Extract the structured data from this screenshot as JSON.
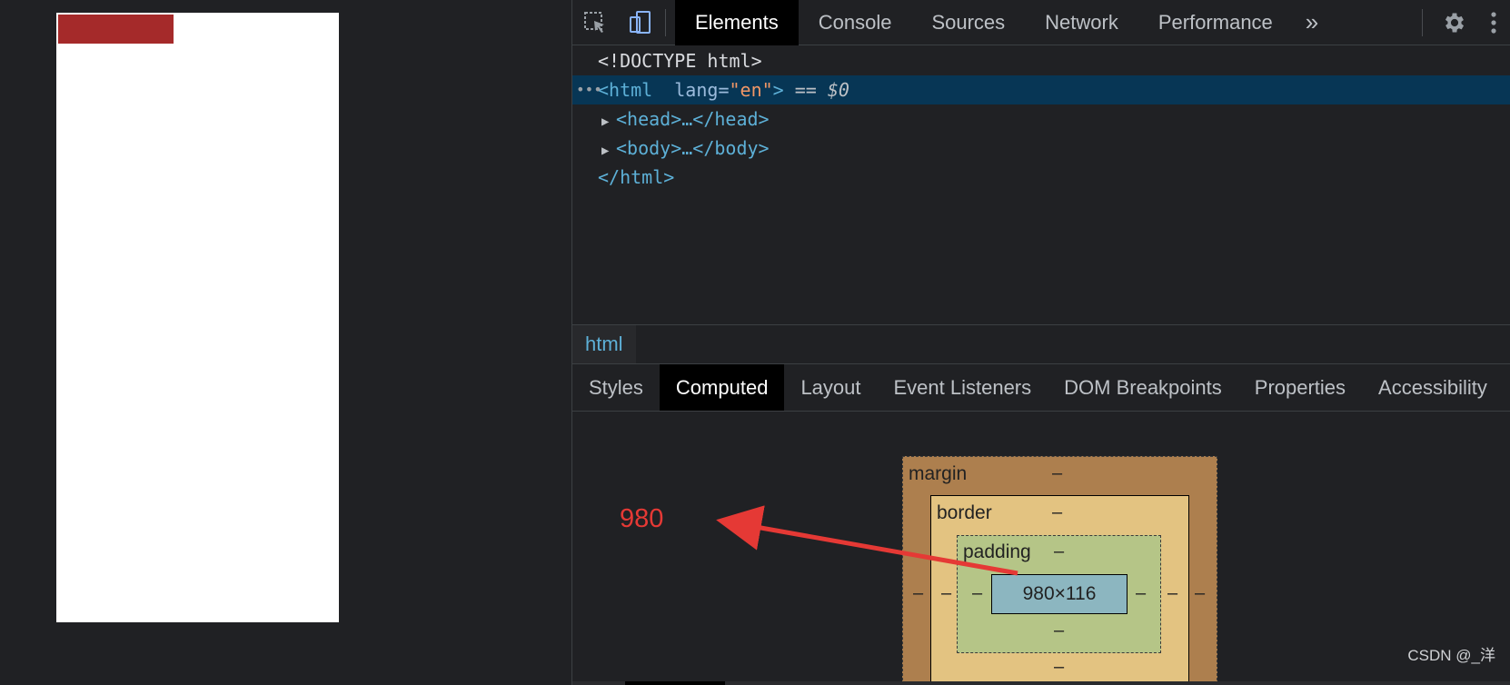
{
  "devtools": {
    "main_tabs": [
      "Elements",
      "Console",
      "Sources",
      "Network",
      "Performance"
    ],
    "more_tabs": "»",
    "dom": {
      "doctype": "<!DOCTYPE html>",
      "html_open_tag": "<html",
      "html_attr_name": "lang",
      "html_attr_eq": "=",
      "html_attr_value": "\"en\"",
      "html_open_close": ">",
      "selected_marker": " == ",
      "selected_var": "$0",
      "head_node": "<head>…</head>",
      "body_node": "<body>…</body>",
      "html_close_tag": "</html>"
    },
    "breadcrumb": "html",
    "sub_tabs": [
      "Styles",
      "Computed",
      "Layout",
      "Event Listeners",
      "DOM Breakpoints",
      "Properties",
      "Accessibility"
    ],
    "box_model": {
      "margin_label": "margin",
      "border_label": "border",
      "padding_label": "padding",
      "dash": "–",
      "content_size": "980×116"
    },
    "annotation": "980"
  },
  "watermark": "CSDN @_洋",
  "colors": {
    "red_box": "#a52a2a",
    "annotation": "#e53935",
    "selection": "#073655"
  },
  "icons": [
    "inspect-element-icon",
    "device-toolbar-icon",
    "gear-icon",
    "kebab-menu-icon",
    "more-tabs-icon"
  ]
}
